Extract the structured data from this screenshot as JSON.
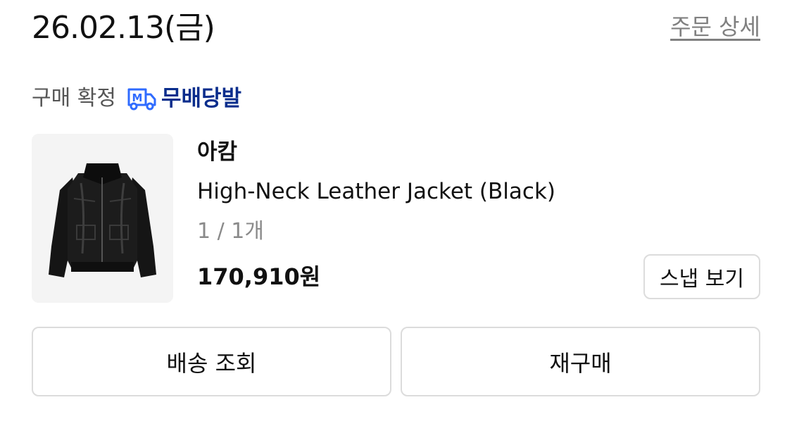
{
  "order": {
    "date": "26.02.13(금)",
    "detail_link": "주문 상세",
    "status": "구매 확정",
    "delivery_badge": {
      "icon": "delivery-truck-m-icon",
      "label": "무배당발",
      "color": "#0a2d8c"
    }
  },
  "product": {
    "image_icon": "leather-jacket-thumbnail",
    "brand": "아캄",
    "name": "High-Neck Leather Jacket (Black)",
    "quantity": "1 / 1개",
    "price": "170,910원",
    "snap_button": "스냅 보기"
  },
  "actions": {
    "track_label": "배송 조회",
    "rebuy_label": "재구매"
  }
}
